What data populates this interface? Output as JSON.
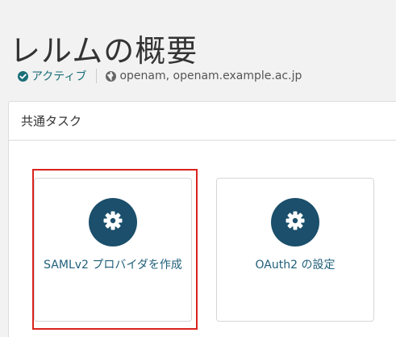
{
  "header": {
    "title": "レルムの概要"
  },
  "meta": {
    "status_label": "アクティブ",
    "status_icon": "check-circle-icon",
    "aliases_icon": "globe-icon",
    "aliases_text": "openam, openam.example.ac.jp"
  },
  "panel": {
    "heading": "共通タスク",
    "tasks": [
      {
        "label": "SAMLv2 プロバイダを作成",
        "icon": "gear-icon",
        "highlighted": true
      },
      {
        "label": "OAuth2 の設定",
        "icon": "gear-icon",
        "highlighted": false
      }
    ]
  },
  "colors": {
    "accent": "#1b4f6b",
    "link": "#1f5f7a",
    "status": "#1a6e78",
    "highlight": "#d9231d"
  }
}
